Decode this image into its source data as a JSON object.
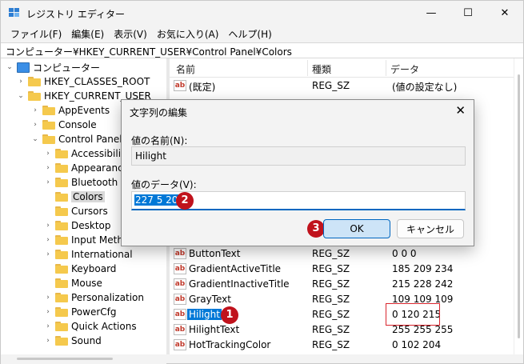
{
  "window": {
    "title": "レジストリ エディター",
    "controls": {
      "minimize": "—",
      "maximize": "☐",
      "close": "✕"
    }
  },
  "menu": [
    "ファイル(F)",
    "編集(E)",
    "表示(V)",
    "お気に入り(A)",
    "ヘルプ(H)"
  ],
  "address": "コンピューター¥HKEY_CURRENT_USER¥Control Panel¥Colors",
  "tree": [
    {
      "label": "コンピューター",
      "chevron": "⌄",
      "icon": "computer-icon"
    },
    {
      "label": "HKEY_CLASSES_ROOT",
      "chevron": "›"
    },
    {
      "label": "HKEY_CURRENT_USER",
      "chevron": "⌄"
    },
    {
      "label": "AppEvents",
      "chevron": "›"
    },
    {
      "label": "Console",
      "chevron": "›"
    },
    {
      "label": "Control Panel",
      "chevron": "⌄"
    },
    {
      "label": "Accessibility",
      "chevron": "›"
    },
    {
      "label": "Appearance",
      "chevron": "›"
    },
    {
      "label": "Bluetooth",
      "chevron": "›"
    },
    {
      "label": "Colors",
      "chevron": "",
      "selected": true
    },
    {
      "label": "Cursors",
      "chevron": ""
    },
    {
      "label": "Desktop",
      "chevron": "›"
    },
    {
      "label": "Input Method",
      "chevron": "›"
    },
    {
      "label": "International",
      "chevron": "›"
    },
    {
      "label": "Keyboard",
      "chevron": ""
    },
    {
      "label": "Mouse",
      "chevron": ""
    },
    {
      "label": "Personalization",
      "chevron": "›"
    },
    {
      "label": "PowerCfg",
      "chevron": "›"
    },
    {
      "label": "Quick Actions",
      "chevron": "›"
    },
    {
      "label": "Sound",
      "chevron": "›"
    }
  ],
  "list": {
    "columns": {
      "name": "名前",
      "type": "種類",
      "data": "データ"
    },
    "rows": [
      {
        "name": "(既定)",
        "type": "REG_SZ",
        "data": "(値の設定なし)"
      },
      {
        "name": "ButtonText",
        "type": "REG_SZ",
        "data": "0 0 0"
      },
      {
        "name": "GradientActiveTitle",
        "type": "REG_SZ",
        "data": "185 209 234"
      },
      {
        "name": "GradientInactiveTitle",
        "type": "REG_SZ",
        "data": "215 228 242"
      },
      {
        "name": "GrayText",
        "type": "REG_SZ",
        "data": "109 109 109"
      },
      {
        "name": "Hilight",
        "type": "REG_SZ",
        "data": "0 120 215",
        "selected": true
      },
      {
        "name": "HilightText",
        "type": "REG_SZ",
        "data": "255 255 255"
      },
      {
        "name": "HotTrackingColor",
        "type": "REG_SZ",
        "data": "0 102 204"
      }
    ]
  },
  "dialog": {
    "title": "文字列の編集",
    "name_label": "値の名前(N):",
    "name_value": "Hilight",
    "data_label": "値のデータ(V):",
    "data_value": "227 5 204",
    "ok": "OK",
    "cancel": "キャンセル",
    "close": "✕"
  },
  "badges": [
    "1",
    "2",
    "3"
  ],
  "colors": {
    "accent": "#0078d7",
    "badge": "#c0121c",
    "folder": "#f5c94d"
  }
}
